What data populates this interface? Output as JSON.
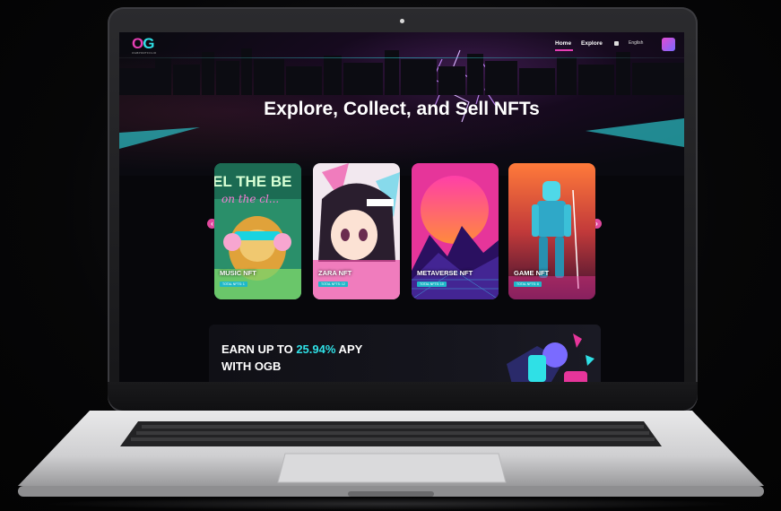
{
  "nav": {
    "logo_text": "OG",
    "logo_subtext": "OGBPORTFOLIO",
    "home": "Home",
    "explore": "Explore",
    "language": "English"
  },
  "hero": {
    "title": "Explore, Collect, and Sell NFTs"
  },
  "cards": [
    {
      "label": "MUSIC NFT",
      "tag": "TOTAL NFTS: 1",
      "art_text_top": "EL THE BE",
      "art_text_script": "on the cl..."
    },
    {
      "label": "ZARA NFT",
      "tag": "TOTAL NFTS: 12"
    },
    {
      "label": "METAVERSE NFT",
      "tag": "TOTAL NFTS: 10"
    },
    {
      "label": "GAME NFT",
      "tag": "TOTAL NFTS: 8"
    }
  ],
  "carousel": {
    "prev_icon": "chevron-left-icon",
    "next_icon": "chevron-right-icon"
  },
  "earn": {
    "prefix": "EARN UP TO ",
    "apy": "25.94%",
    "suffix": " APY",
    "line2": "WITH OGB"
  },
  "colors": {
    "accent_pink": "#e63fb4",
    "accent_cyan": "#2fe0e6",
    "background": "#07070b"
  }
}
